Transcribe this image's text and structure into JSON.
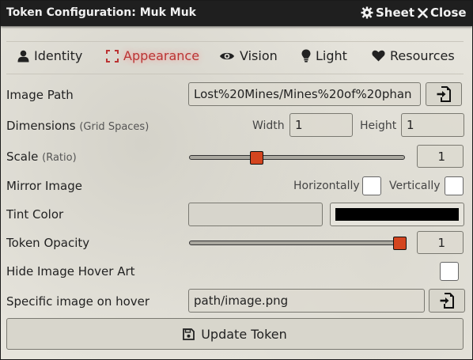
{
  "window": {
    "title": "Token Configuration: Muk Muk",
    "sheet_label": "Sheet",
    "close_label": "Close"
  },
  "tabs": [
    {
      "label": "Identity",
      "icon": "user-icon"
    },
    {
      "label": "Appearance",
      "icon": "expand-icon",
      "active": true
    },
    {
      "label": "Vision",
      "icon": "eye-icon"
    },
    {
      "label": "Light",
      "icon": "lightbulb-icon"
    },
    {
      "label": "Resources",
      "icon": "heart-icon"
    }
  ],
  "image_path": {
    "label": "Image Path",
    "value": "Lost%20Mines/Mines%20of%20phan"
  },
  "dimensions": {
    "label": "Dimensions",
    "hint": "(Grid Spaces)",
    "width_label": "Width",
    "width_value": "1",
    "height_label": "Height",
    "height_value": "1"
  },
  "scale": {
    "label": "Scale",
    "hint": "(Ratio)",
    "value": "1",
    "slider_fraction": 0.3
  },
  "mirror": {
    "label": "Mirror Image",
    "horizontal_label": "Horizontally",
    "vertical_label": "Vertically"
  },
  "tint": {
    "label": "Tint Color",
    "color": "#000000"
  },
  "opacity": {
    "label": "Token Opacity",
    "value": "1",
    "slider_fraction": 1.0
  },
  "hide_hover": {
    "label": "Hide Image Hover Art"
  },
  "hover_image": {
    "label": "Specific image on hover",
    "value": "path/image.png"
  },
  "update_label": "Update Token"
}
